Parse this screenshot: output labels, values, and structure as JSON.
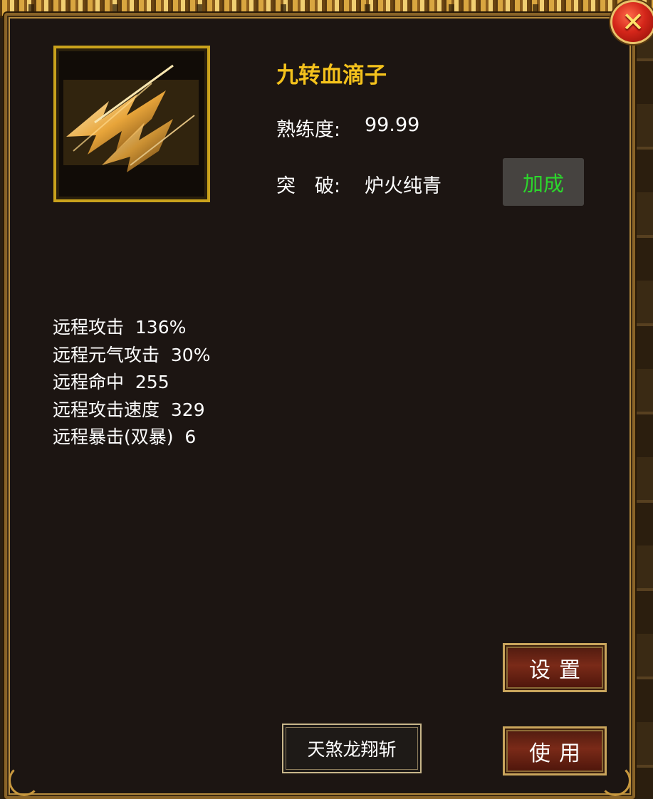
{
  "window": {
    "close_icon": "close-x-icon"
  },
  "skill": {
    "icon": "triple-arrow-skill-icon",
    "name": "九转血滴子",
    "proficiency_label": "熟练度:",
    "proficiency_value": "99.99",
    "breakthrough_label": "突　破:",
    "breakthrough_value": "炉火纯青",
    "bonus_button": "加成"
  },
  "attributes": [
    "远程攻击  136%",
    "远程元气攻击  30%",
    "远程命中  255",
    "远程攻击速度  329",
    "远程暴击(双暴)  6"
  ],
  "actions": {
    "settings": "设置",
    "use": "使用",
    "auto_skill": "天煞龙翔斩"
  },
  "colors": {
    "skill_name": "#f4c21c",
    "bonus_text": "#2cd62c",
    "panel_bg": "#1c1512",
    "frame_gold": "#c9a21c"
  }
}
